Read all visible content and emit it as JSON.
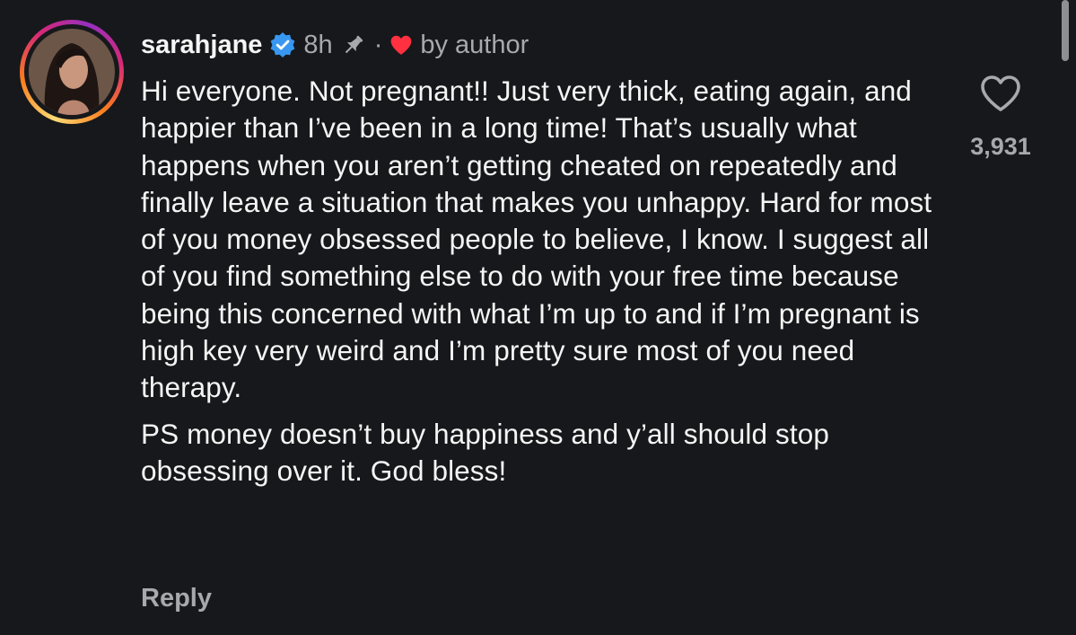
{
  "comment": {
    "username": "sarahjane",
    "verified_icon": "verified-badge-icon",
    "time": "8h",
    "pin_icon": "pin-icon",
    "separator": "·",
    "liked_by_author_icon": "heart-filled-icon",
    "liked_by_author_text": "by author",
    "body": "Hi everyone. Not pregnant!! Just very thick, eating again, and happier than I’ve been in a long time! That’s usually what happens when you aren’t getting cheated on repeatedly and finally leave a situation that makes you unhappy. Hard for most of you money obsessed people to believe, I know. I suggest all of you find something else to do with your free time because being this concerned with what I’m up to and if I’m pregnant is high key very weird and I’m pretty sure most of you need therapy.",
    "body_ps": "PS money doesn’t buy happiness and y’all should stop obsessing over it. God bless!",
    "reply_label": "Reply",
    "like_icon": "heart-outline-icon",
    "like_count": "3,931"
  },
  "colors": {
    "background": "#16181b",
    "text_primary": "#f5f5f5",
    "text_secondary": "#a8a8ad",
    "verified_blue": "#3897f0",
    "heart_red": "#ff3040"
  }
}
